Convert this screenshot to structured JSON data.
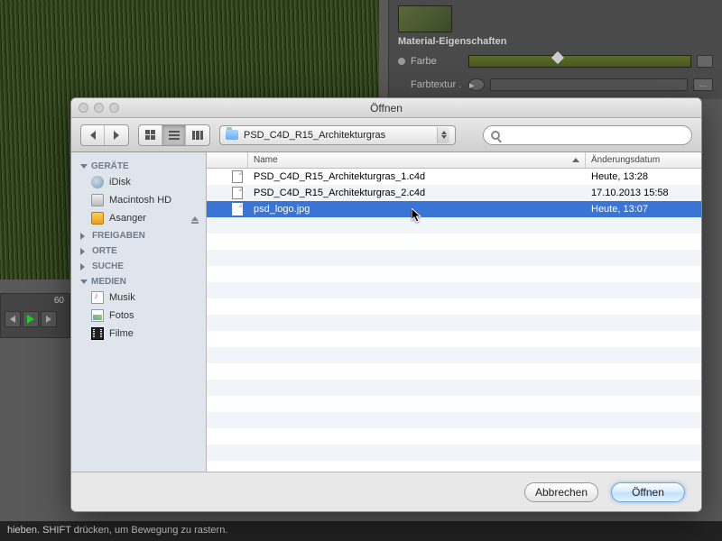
{
  "bg": {
    "panel_title": "Material-Eigenschaften",
    "color_label": "Farbe",
    "texture_label": "Farbtextur .",
    "timeline_number": "60"
  },
  "statusbar": {
    "text": "hieben. SHIFT drücken, um Bewegung zu rastern."
  },
  "dialog": {
    "title": "Öffnen",
    "current_folder": "PSD_C4D_R15_Architekturgras",
    "search_placeholder": "",
    "columns": {
      "name": "Name",
      "date": "Änderungsdatum"
    },
    "buttons": {
      "cancel": "Abbrechen",
      "open": "Öffnen"
    }
  },
  "sidebar": {
    "sections": {
      "devices": "GERÄTE",
      "shared": "FREIGABEN",
      "places": "ORTE",
      "search": "SUCHE",
      "media": "MEDIEN"
    },
    "devices": [
      {
        "label": "iDisk"
      },
      {
        "label": "Macintosh HD"
      },
      {
        "label": "Asanger"
      }
    ],
    "media": [
      {
        "label": "Musik"
      },
      {
        "label": "Fotos"
      },
      {
        "label": "Filme"
      }
    ]
  },
  "files": [
    {
      "name": "PSD_C4D_R15_Architekturgras_1.c4d",
      "date": "Heute, 13:28",
      "type": "c4d",
      "selected": false
    },
    {
      "name": "PSD_C4D_R15_Architekturgras_2.c4d",
      "date": "17.10.2013 15:58",
      "type": "c4d",
      "selected": false
    },
    {
      "name": "psd_logo.jpg",
      "date": "Heute, 13:07",
      "type": "jpg",
      "selected": true
    }
  ]
}
